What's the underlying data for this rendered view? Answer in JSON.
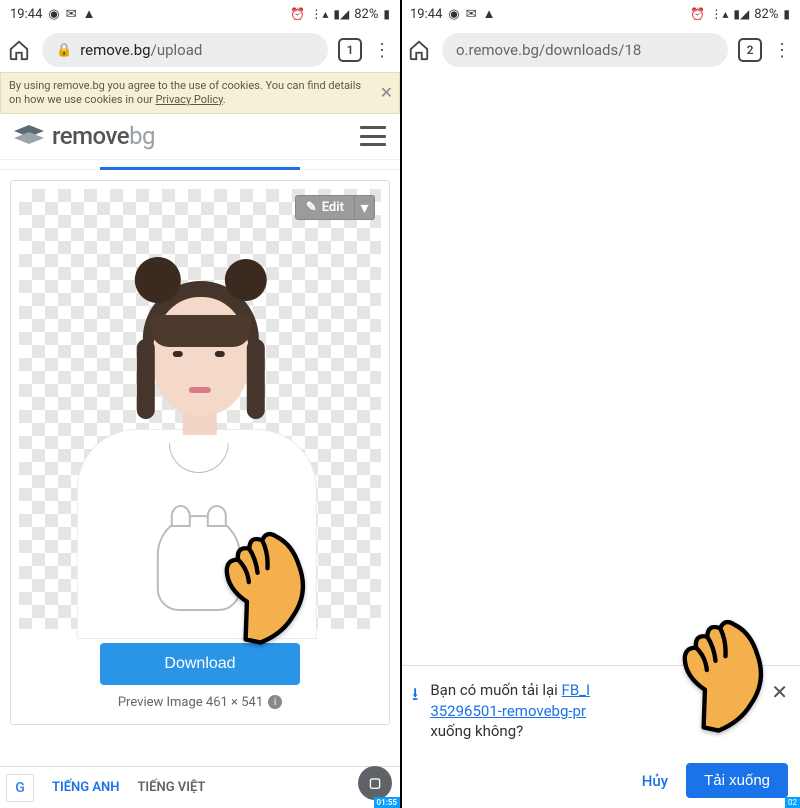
{
  "status": {
    "time": "19:44",
    "battery_pct": "82%"
  },
  "left": {
    "url_host": "remove.bg",
    "url_path": "/upload",
    "tab_count": "1",
    "cookie_text_a": "By using remove.bg you agree to the use of cookies. You can find details on how we use cookies in our ",
    "cookie_link": "Privacy Policy",
    "cookie_text_b": ".",
    "brand_a": "remove",
    "brand_b": "bg",
    "edit_label": "Edit",
    "download_label": "Download",
    "preview_label": "Preview Image 461 × 541",
    "translate_lang_a": "TIẾNG ANH",
    "translate_lang_b": "TIẾNG VIỆT",
    "translate_tag": "01:55"
  },
  "right": {
    "url_text": "o.remove.bg/downloads/18",
    "tab_count": "2",
    "prompt_a": "Bạn có muốn tải lại ",
    "prompt_link1": "FB_I",
    "prompt_link2": "35296501-removebg-pr",
    "prompt_b": " xuống không?",
    "cancel_label": "Hủy",
    "confirm_label": "Tải xuống",
    "tag": "02"
  }
}
